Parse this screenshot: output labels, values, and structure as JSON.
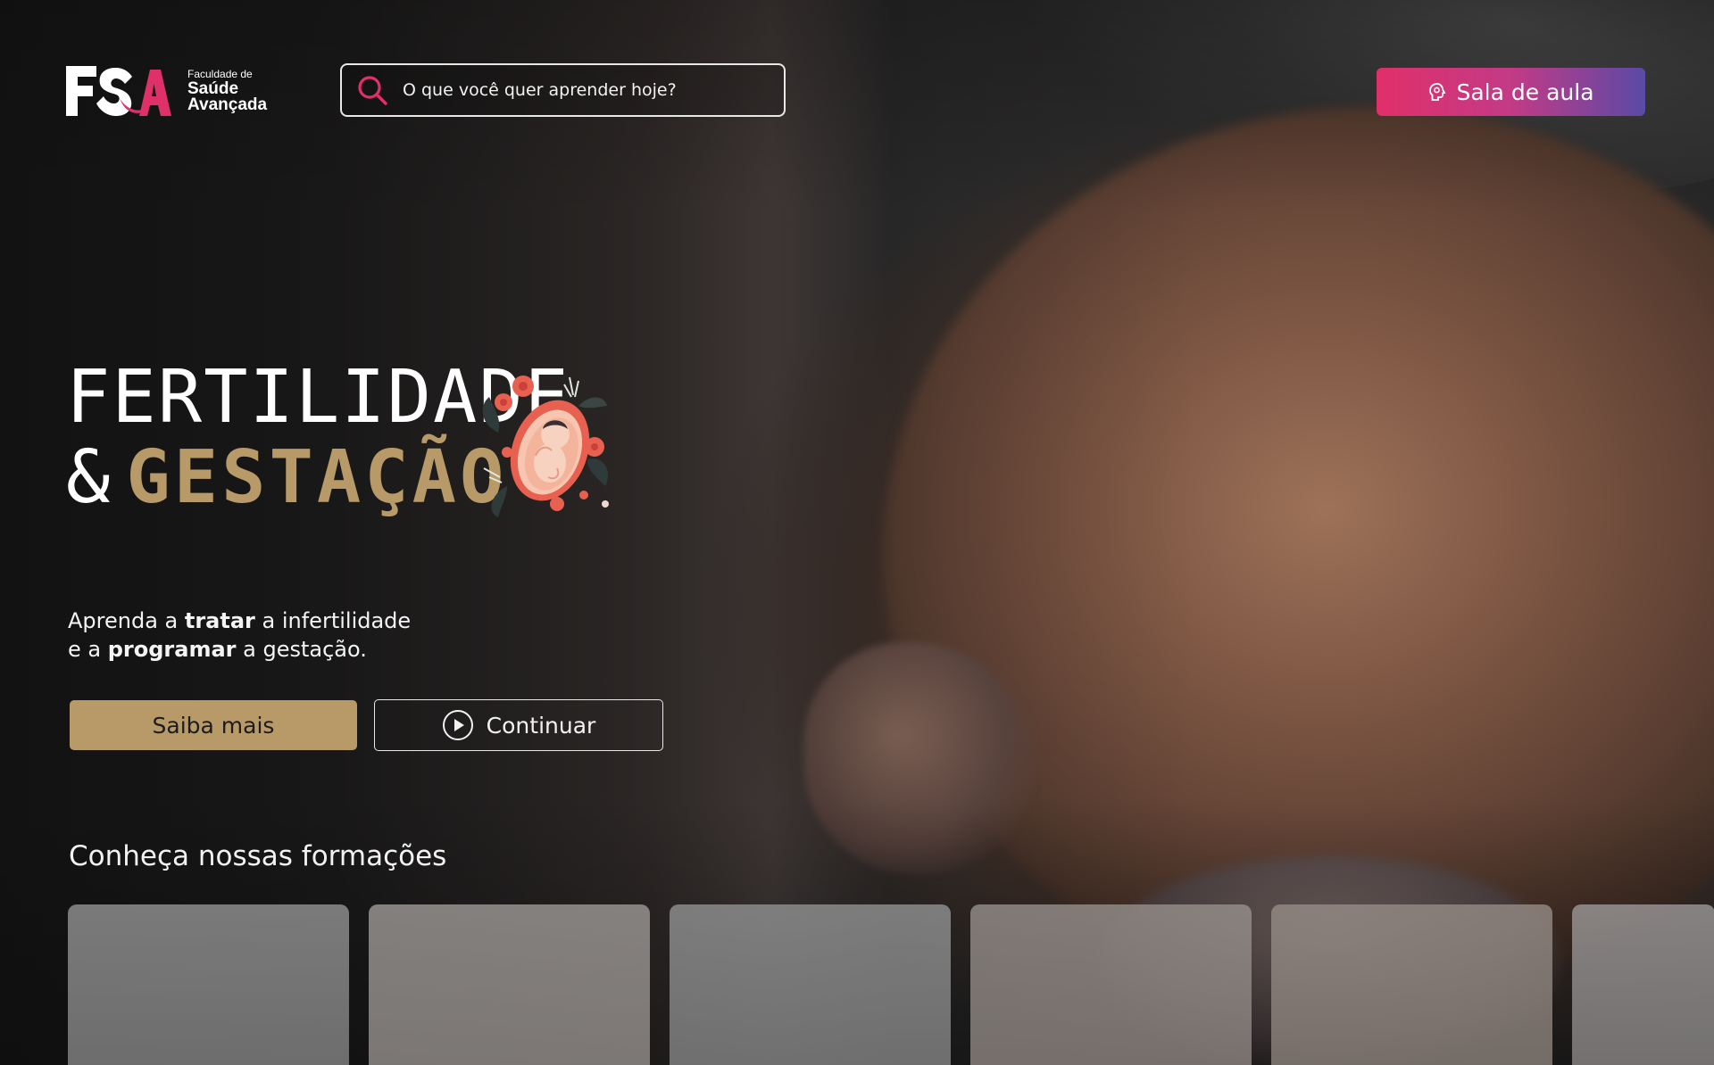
{
  "brand": {
    "mark": "FSA",
    "name_small": "Faculdade de",
    "name_line1": "Saúde",
    "name_line2": "Avançada",
    "accent_color": "#e0306a"
  },
  "search": {
    "placeholder": "O que você quer aprender hoje?",
    "value": "",
    "icon": "search-icon"
  },
  "header": {
    "classroom_button_label": "Sala de aula",
    "classroom_button_icon": "head-icon"
  },
  "hero": {
    "title_line1": "FERTILIDADE",
    "title_amp": "&",
    "title_line2": "GESTAÇÃO",
    "title_highlight_color": "#b89a68",
    "description": {
      "line1_pre": "Aprenda a ",
      "line1_bold": "tratar",
      "line1_post": " a infertilidade",
      "line2_pre": "e a ",
      "line2_bold": "programar",
      "line2_post": " a gestação."
    },
    "primary_button_label": "Saiba mais",
    "secondary_button_label": "Continuar",
    "secondary_button_icon": "play-icon"
  },
  "formations": {
    "section_title": "Conheça nossas formações",
    "cards": [
      {
        "id": "card-1"
      },
      {
        "id": "card-2"
      },
      {
        "id": "card-3"
      },
      {
        "id": "card-4"
      },
      {
        "id": "card-5"
      },
      {
        "id": "card-6"
      }
    ]
  }
}
